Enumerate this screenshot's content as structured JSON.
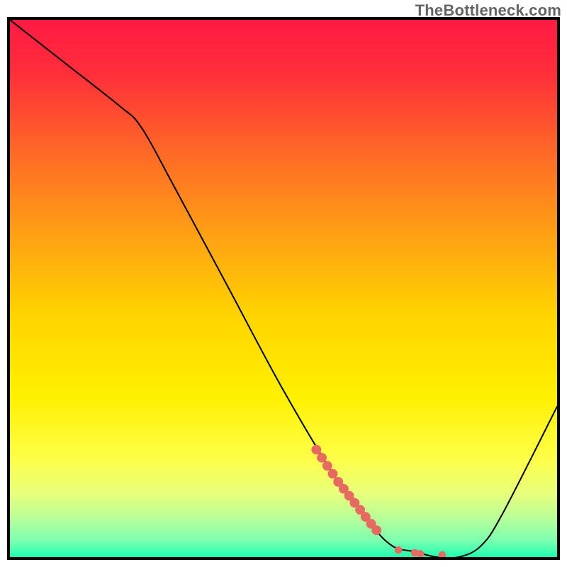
{
  "watermark": "TheBottleneck.com",
  "chart_data": {
    "type": "line",
    "title": "",
    "xlabel": "",
    "ylabel": "",
    "xlim": [
      0,
      100
    ],
    "ylim": [
      0,
      100
    ],
    "gradient_stops": [
      {
        "offset": 0.0,
        "color": "#ff1a44"
      },
      {
        "offset": 0.1,
        "color": "#ff2e3a"
      },
      {
        "offset": 0.25,
        "color": "#ff6a26"
      },
      {
        "offset": 0.4,
        "color": "#ffa014"
      },
      {
        "offset": 0.55,
        "color": "#ffd400"
      },
      {
        "offset": 0.7,
        "color": "#fff000"
      },
      {
        "offset": 0.82,
        "color": "#fdff4a"
      },
      {
        "offset": 0.88,
        "color": "#e9ff7a"
      },
      {
        "offset": 0.93,
        "color": "#b6ff9a"
      },
      {
        "offset": 0.97,
        "color": "#7affb0"
      },
      {
        "offset": 1.0,
        "color": "#1dffb0"
      }
    ],
    "series": [
      {
        "name": "bottleneck-curve",
        "x": [
          0,
          10,
          20,
          24,
          30,
          40,
          50,
          60,
          66,
          70,
          74,
          78,
          82,
          86,
          90,
          100
        ],
        "y": [
          100,
          92,
          84,
          80,
          69,
          50,
          31,
          14,
          6,
          2,
          1,
          0,
          0,
          2,
          8,
          28
        ]
      }
    ],
    "scatter": [
      {
        "name": "highlight-segment",
        "color": "#e76a62",
        "points": [
          {
            "x": 56,
            "y": 20
          },
          {
            "x": 57,
            "y": 18.5
          },
          {
            "x": 58,
            "y": 17
          },
          {
            "x": 59,
            "y": 15.5
          },
          {
            "x": 60,
            "y": 14
          },
          {
            "x": 61,
            "y": 12.7
          },
          {
            "x": 62,
            "y": 11.4
          },
          {
            "x": 63,
            "y": 10.1
          },
          {
            "x": 64,
            "y": 8.8
          },
          {
            "x": 65,
            "y": 7.5
          },
          {
            "x": 66,
            "y": 6.2
          },
          {
            "x": 67,
            "y": 5.0
          }
        ]
      },
      {
        "name": "highlight-dots",
        "color": "#e76a62",
        "points": [
          {
            "x": 71,
            "y": 1.3
          },
          {
            "x": 74,
            "y": 0.8
          },
          {
            "x": 75,
            "y": 0.6
          },
          {
            "x": 79,
            "y": 0.4
          }
        ]
      }
    ]
  }
}
